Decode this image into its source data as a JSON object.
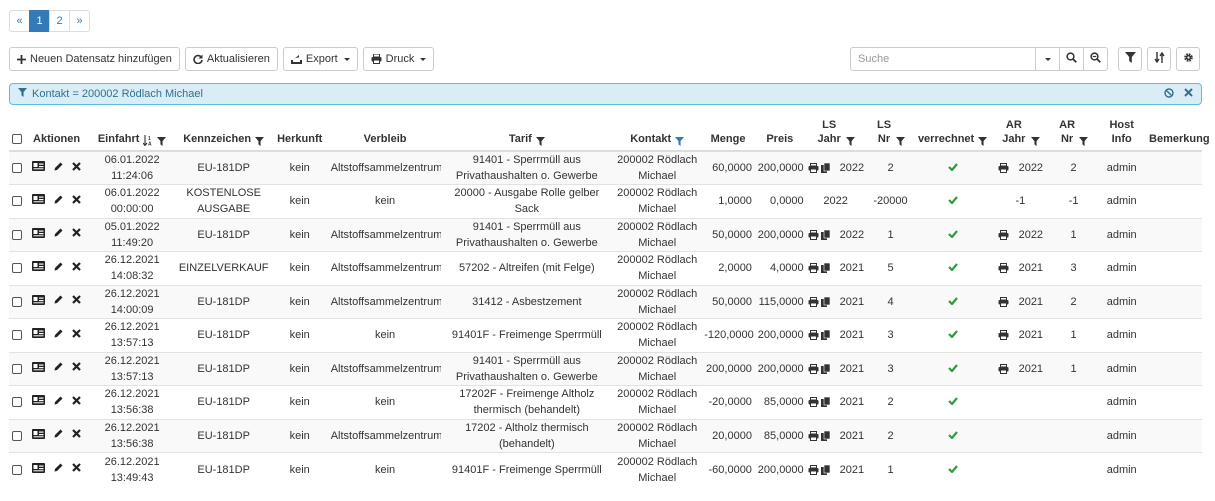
{
  "pagination": {
    "prev": "«",
    "pages": [
      "1",
      "2"
    ],
    "active": "1",
    "next": "»"
  },
  "toolbar": {
    "add_label": "Neuen Datensatz hinzufügen",
    "refresh_label": "Aktualisieren",
    "export_label": "Export",
    "print_label": "Druck"
  },
  "search": {
    "placeholder": "Suche",
    "value": ""
  },
  "filter": {
    "text": "Kontakt = 200002 Rödlach Michael"
  },
  "columns": {
    "aktionen": "Aktionen",
    "einfahrt": "Einfahrt",
    "kennzeichen": "Kennzeichen",
    "herkunft": "Herkunft",
    "verbleib": "Verbleib",
    "tarif": "Tarif",
    "kontakt": "Kontakt",
    "menge": "Menge",
    "preis": "Preis",
    "ls_jahr": "LS Jahr",
    "ls_nr": "LS Nr",
    "verrechnet": "verrechnet",
    "ar_jahr": "AR Jahr",
    "ar_nr": "AR Nr",
    "host": "Host Info",
    "bemerkung": "Bemerkung"
  },
  "rows": [
    {
      "einfahrt_date": "06.01.2022",
      "einfahrt_time": "11:24:06",
      "kennzeichen": "EU-181DP",
      "herkunft": "kein",
      "verbleib": "Altstoffsammelzentrum",
      "tarif": "91401 - Sperrmüll aus Privathaushalten o. Gewerbe",
      "kontakt": "200002 Rödlach Michael",
      "menge": "60,0000",
      "preis": "200,0000",
      "ls_icons": true,
      "ls_jahr": "2022",
      "ls_nr": "2",
      "verrechnet": true,
      "ar_icon": true,
      "ar_jahr": "2022",
      "ar_nr": "2",
      "host": "admin",
      "bemerkung": ""
    },
    {
      "einfahrt_date": "06.01.2022",
      "einfahrt_time": "00:00:00",
      "kennzeichen": "KOSTENLOSE AUSGABE",
      "herkunft": "kein",
      "verbleib": "kein",
      "tarif": "20000 - Ausgabe Rolle gelber Sack",
      "kontakt": "200002 Rödlach Michael",
      "menge": "1,0000",
      "preis": "0,0000",
      "ls_icons": false,
      "ls_jahr": "2022",
      "ls_nr": "-20000",
      "verrechnet": true,
      "ar_icon": false,
      "ar_jahr": "-1",
      "ar_nr": "-1",
      "host": "admin",
      "bemerkung": ""
    },
    {
      "einfahrt_date": "05.01.2022",
      "einfahrt_time": "11:49:20",
      "kennzeichen": "EU-181DP",
      "herkunft": "kein",
      "verbleib": "Altstoffsammelzentrum",
      "tarif": "91401 - Sperrmüll aus Privathaushalten o. Gewerbe",
      "kontakt": "200002 Rödlach Michael",
      "menge": "50,0000",
      "preis": "200,0000",
      "ls_icons": true,
      "ls_jahr": "2022",
      "ls_nr": "1",
      "verrechnet": true,
      "ar_icon": true,
      "ar_jahr": "2022",
      "ar_nr": "1",
      "host": "admin",
      "bemerkung": ""
    },
    {
      "einfahrt_date": "26.12.2021",
      "einfahrt_time": "14:08:32",
      "kennzeichen": "EINZELVERKAUF",
      "herkunft": "kein",
      "verbleib": "Altstoffsammelzentrum",
      "tarif": "57202 - Altreifen (mit Felge)",
      "kontakt": "200002 Rödlach Michael",
      "menge": "2,0000",
      "preis": "4,0000",
      "ls_icons": true,
      "ls_jahr": "2021",
      "ls_nr": "5",
      "verrechnet": true,
      "ar_icon": true,
      "ar_jahr": "2021",
      "ar_nr": "3",
      "host": "admin",
      "bemerkung": ""
    },
    {
      "einfahrt_date": "26.12.2021",
      "einfahrt_time": "14:00:09",
      "kennzeichen": "EU-181DP",
      "herkunft": "kein",
      "verbleib": "Altstoffsammelzentrum",
      "tarif": "31412 - Asbestzement",
      "kontakt": "200002 Rödlach Michael",
      "menge": "50,0000",
      "preis": "115,0000",
      "ls_icons": true,
      "ls_jahr": "2021",
      "ls_nr": "4",
      "verrechnet": true,
      "ar_icon": true,
      "ar_jahr": "2021",
      "ar_nr": "2",
      "host": "admin",
      "bemerkung": ""
    },
    {
      "einfahrt_date": "26.12.2021",
      "einfahrt_time": "13:57:13",
      "kennzeichen": "EU-181DP",
      "herkunft": "kein",
      "verbleib": "kein",
      "tarif": "91401F - Freimenge Sperrmüll",
      "kontakt": "200002 Rödlach Michael",
      "menge": "-120,0000",
      "preis": "200,0000",
      "ls_icons": true,
      "ls_jahr": "2021",
      "ls_nr": "3",
      "verrechnet": true,
      "ar_icon": true,
      "ar_jahr": "2021",
      "ar_nr": "1",
      "host": "admin",
      "bemerkung": ""
    },
    {
      "einfahrt_date": "26.12.2021",
      "einfahrt_time": "13:57:13",
      "kennzeichen": "EU-181DP",
      "herkunft": "kein",
      "verbleib": "Altstoffsammelzentrum",
      "tarif": "91401 - Sperrmüll aus Privathaushalten o. Gewerbe",
      "kontakt": "200002 Rödlach Michael",
      "menge": "200,0000",
      "preis": "200,0000",
      "ls_icons": true,
      "ls_jahr": "2021",
      "ls_nr": "3",
      "verrechnet": true,
      "ar_icon": true,
      "ar_jahr": "2021",
      "ar_nr": "1",
      "host": "admin",
      "bemerkung": ""
    },
    {
      "einfahrt_date": "26.12.2021",
      "einfahrt_time": "13:56:38",
      "kennzeichen": "EU-181DP",
      "herkunft": "kein",
      "verbleib": "kein",
      "tarif": "17202F - Freimenge Altholz thermisch (behandelt)",
      "kontakt": "200002 Rödlach Michael",
      "menge": "-20,0000",
      "preis": "85,0000",
      "ls_icons": true,
      "ls_jahr": "2021",
      "ls_nr": "2",
      "verrechnet": true,
      "ar_icon": false,
      "ar_jahr": "",
      "ar_nr": "",
      "host": "admin",
      "bemerkung": ""
    },
    {
      "einfahrt_date": "26.12.2021",
      "einfahrt_time": "13:56:38",
      "kennzeichen": "EU-181DP",
      "herkunft": "kein",
      "verbleib": "Altstoffsammelzentrum",
      "tarif": "17202 - Altholz thermisch (behandelt)",
      "kontakt": "200002 Rödlach Michael",
      "menge": "20,0000",
      "preis": "85,0000",
      "ls_icons": true,
      "ls_jahr": "2021",
      "ls_nr": "2",
      "verrechnet": true,
      "ar_icon": false,
      "ar_jahr": "",
      "ar_nr": "",
      "host": "admin",
      "bemerkung": ""
    },
    {
      "einfahrt_date": "26.12.2021",
      "einfahrt_time": "13:49:43",
      "kennzeichen": "EU-181DP",
      "herkunft": "kein",
      "verbleib": "kein",
      "tarif": "91401F - Freimenge Sperrmüll",
      "kontakt": "200002 Rödlach Michael",
      "menge": "-60,0000",
      "preis": "200,0000",
      "ls_icons": true,
      "ls_jahr": "2021",
      "ls_nr": "1",
      "verrechnet": true,
      "ar_icon": false,
      "ar_jahr": "",
      "ar_nr": "",
      "host": "admin",
      "bemerkung": ""
    }
  ],
  "colors": {
    "primary": "#337ab7",
    "filter_bg": "#d9edf7",
    "filter_border": "#5bc0de",
    "check": "#2e9c3e"
  }
}
